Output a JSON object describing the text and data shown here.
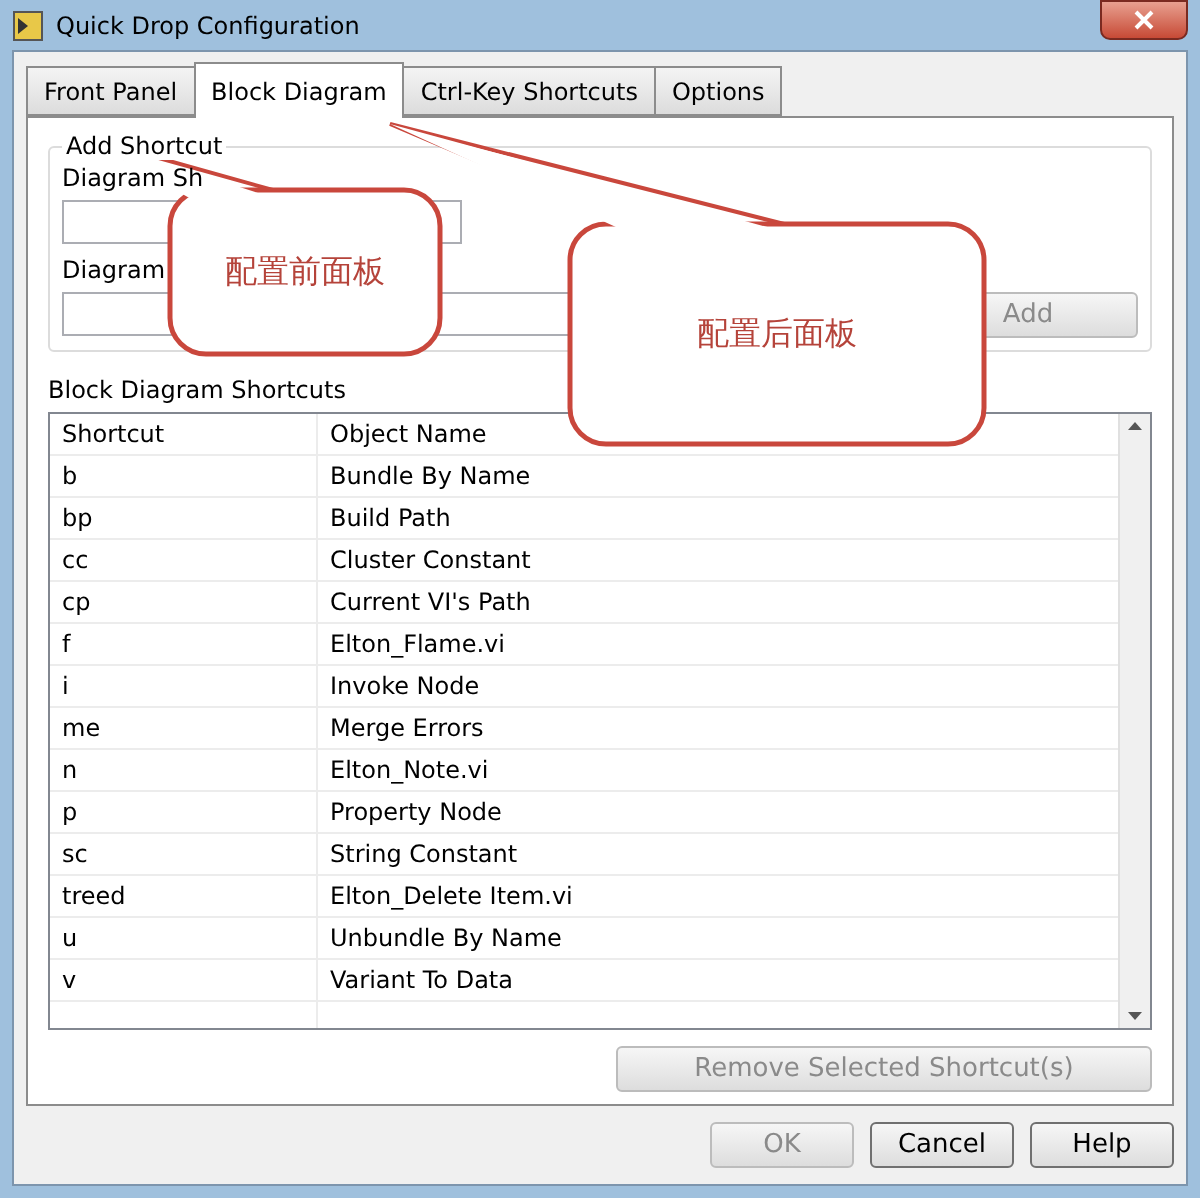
{
  "window": {
    "title": "Quick Drop Configuration"
  },
  "tabs": [
    {
      "label": "Front Panel",
      "selected": false
    },
    {
      "label": "Block Diagram",
      "selected": true
    },
    {
      "label": "Ctrl-Key Shortcuts",
      "selected": false
    },
    {
      "label": "Options",
      "selected": false
    }
  ],
  "add_shortcut": {
    "title": "Add Shortcut",
    "shortcut_label": "Diagram Sh",
    "name_label": "Diagram",
    "add_button": {
      "label": "Add",
      "disabled": true
    }
  },
  "list_title": "Block Diagram Shortcuts",
  "columns": [
    "Shortcut",
    "Object Name"
  ],
  "rows": [
    [
      "b",
      "Bundle By Name"
    ],
    [
      "bp",
      "Build Path"
    ],
    [
      "cc",
      "Cluster Constant"
    ],
    [
      "cp",
      "Current VI's Path"
    ],
    [
      "f",
      "Elton_Flame.vi"
    ],
    [
      "i",
      "Invoke Node"
    ],
    [
      "me",
      "Merge Errors"
    ],
    [
      "n",
      "Elton_Note.vi"
    ],
    [
      "p",
      "Property Node"
    ],
    [
      "sc",
      "String Constant"
    ],
    [
      "treed",
      "Elton_Delete Item.vi"
    ],
    [
      "u",
      "Unbundle By Name"
    ],
    [
      "v",
      "Variant To Data"
    ]
  ],
  "remove_button": {
    "label": "Remove Selected Shortcut(s)",
    "disabled": true
  },
  "buttons": [
    {
      "label": "OK",
      "disabled": true
    },
    {
      "label": "Cancel",
      "disabled": false
    },
    {
      "label": "Help",
      "disabled": false
    }
  ],
  "callouts": [
    {
      "text": "配置前面板"
    },
    {
      "text": "配置后面板"
    }
  ]
}
